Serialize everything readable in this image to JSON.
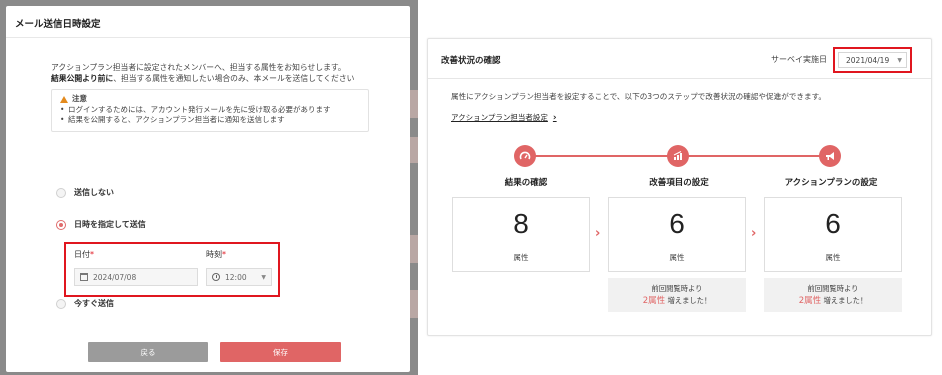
{
  "modal": {
    "title": "メール送信日時設定",
    "intro_line1": "アクションプラン担当者に設定されたメンバーへ、担当する属性をお知らせします。",
    "intro_bold": "結果公開より前に",
    "intro_rest": "、担当する属性を通知したい場合のみ、本メールを送信してください",
    "notice_title": "注意",
    "notice_items": [
      "ログインするためには、アカウント発行メールを先に受け取る必要があります",
      "結果を公開すると、アクションプラン担当者に通知を送信します"
    ],
    "options": {
      "no_send": "送信しない",
      "scheduled": "日時を指定して送信",
      "now": "今すぐ送信"
    },
    "date_label": "日付",
    "time_label": "時刻",
    "required_mark": "*",
    "date_value": "2024/07/08",
    "time_value": "12:00",
    "back_label": "戻る",
    "save_label": "保存"
  },
  "card": {
    "title": "改善状況の確認",
    "survey_label": "サーベイ実施日",
    "survey_date": "2021/04/19",
    "description": "属性にアクションプラン担当者を設定することで、以下の3つのステップで改善状況の確認や促進ができます。",
    "settings_link": "アクションプラン担当者設定",
    "steps": [
      {
        "title": "結果の確認",
        "value": "8",
        "unit": "属性"
      },
      {
        "title": "改善項目の設定",
        "value": "6",
        "unit": "属性",
        "delta_prefix": "前回閲覧時より",
        "delta_highlight": "2属性",
        "delta_suffix": " 増えました！"
      },
      {
        "title": "アクションプランの設定",
        "value": "6",
        "unit": "属性",
        "delta_prefix": "前回閲覧時より",
        "delta_highlight": "2属性",
        "delta_suffix": " 増えました！"
      }
    ]
  },
  "colors": {
    "accent": "#e06565",
    "highlight_border": "#e0161f",
    "warning": "#e38a1d"
  },
  "icons": [
    "warning-icon",
    "calendar-icon",
    "clock-icon",
    "gauge-icon",
    "chart-icon",
    "megaphone-icon",
    "chevron-right-icon",
    "chevron-down-icon"
  ]
}
